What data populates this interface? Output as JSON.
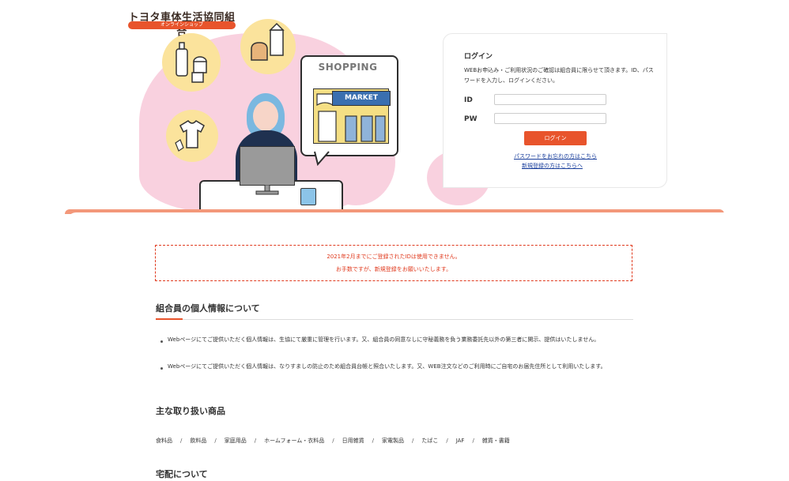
{
  "header": {
    "logo_title": "トヨタ車体生活協同組合",
    "logo_subtitle": "オンラインショップ",
    "illustration_sign": "SHOPPING",
    "illustration_market": "MARKET"
  },
  "login": {
    "title": "ログイン",
    "description": "WEBお申込み・ご利用状況のご確認は組合員に限らせて頂きます。ID、パスワードを入力し、ログインください。",
    "id_label": "ID",
    "pw_label": "PW",
    "id_value": "",
    "pw_value": "",
    "button_label": "ログイン",
    "forgot_link": "パスワードをお忘れの方はこちら",
    "register_link": "新規登録の方はこちらへ"
  },
  "notice": {
    "line1": "2021年2月までにご登録されたIDは使用できません。",
    "line2": "お手数ですが、新規登録をお願いいたします。"
  },
  "privacy": {
    "title": "組合員の個人情報について",
    "items": [
      "Webページにてご提供いただく個人情報は、生協にて厳重に管理を行います。又、組合員の同意なしに守秘義務を負う業務委託先以外の第三者に開示、提供はいたしません。",
      "Webページにてご提供いただく個人情報は、なりすましの防止のため組合員台帳と照合いたします。又、WEB注文などのご利用時にご自宅のお届先住所として利用いたします。"
    ]
  },
  "products": {
    "title": "主な取り扱い商品",
    "categories": [
      "食料品",
      "飲料品",
      "家庭用品",
      "ホームフォーム・衣料品",
      "日用雑貨",
      "家電製品",
      "たばこ",
      "JAF",
      "雑貨・書籍"
    ]
  },
  "delivery": {
    "title": "宅配について"
  },
  "colors": {
    "accent": "#e8542c",
    "notice_red": "#e03a1e",
    "link_blue": "#1a3f9c",
    "pink": "#f9d1df",
    "yellow": "#fbe39c"
  }
}
